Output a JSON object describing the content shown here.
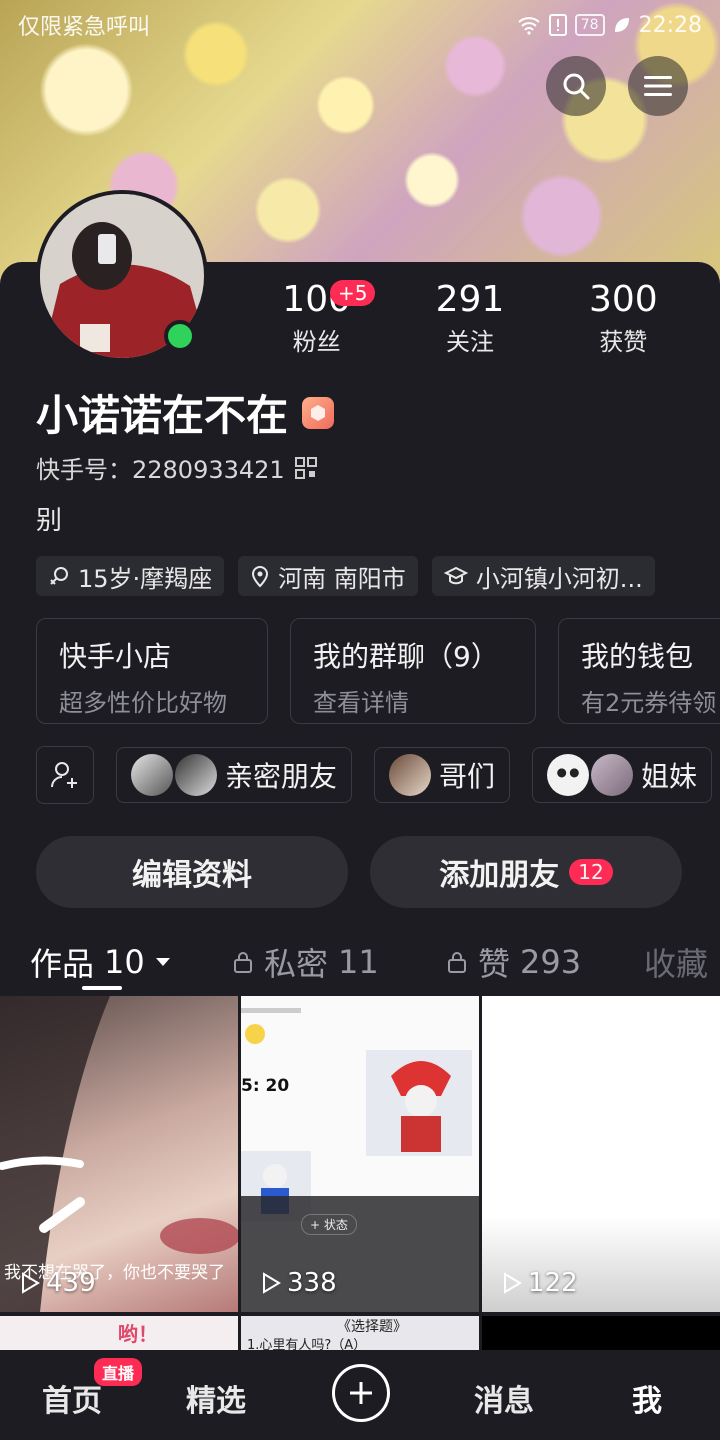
{
  "status_bar": {
    "left_text": "仅限紧急呼叫",
    "battery": "78",
    "time": "22:28"
  },
  "profile": {
    "stats": [
      {
        "value": "100",
        "label": "粉丝",
        "badge": "+5"
      },
      {
        "value": "291",
        "label": "关注"
      },
      {
        "value": "300",
        "label": "获赞"
      }
    ],
    "name": "小诺诺在不在",
    "kuaishou_id": "快手号：2280933421",
    "bio": "别",
    "tags": [
      "15岁·摩羯座",
      "河南 南阳市",
      "小河镇小河初..."
    ]
  },
  "cards": [
    {
      "title": "快手小店",
      "sub": "超多性价比好物"
    },
    {
      "title": "我的群聊（9）",
      "sub": "查看详情"
    },
    {
      "title": "我的钱包",
      "sub": "有2元券待领"
    }
  ],
  "friends": [
    {
      "label": "亲密朋友"
    },
    {
      "label": "哥们"
    },
    {
      "label": "姐妹"
    }
  ],
  "actions": {
    "edit": "编辑资料",
    "add": "添加朋友",
    "add_badge": "12"
  },
  "tabs": {
    "works": "作品",
    "works_count": "10",
    "private": "私密",
    "private_count": "11",
    "likes": "赞",
    "likes_count": "293",
    "favorites": "收藏"
  },
  "videos": [
    {
      "plays": "439",
      "caption": "我不想在哭了，你也不要哭了"
    },
    {
      "plays": "338",
      "time_text": "5: 20",
      "status_text": "+ 状态"
    },
    {
      "plays": "122"
    }
  ],
  "row2": {
    "text_a": "哟！",
    "text_b": "《选择题》",
    "text_c": "1.心里有人吗?（A）"
  },
  "bottom_nav": {
    "home": "首页",
    "live_badge": "直播",
    "featured": "精选",
    "messages": "消息",
    "me": "我"
  }
}
